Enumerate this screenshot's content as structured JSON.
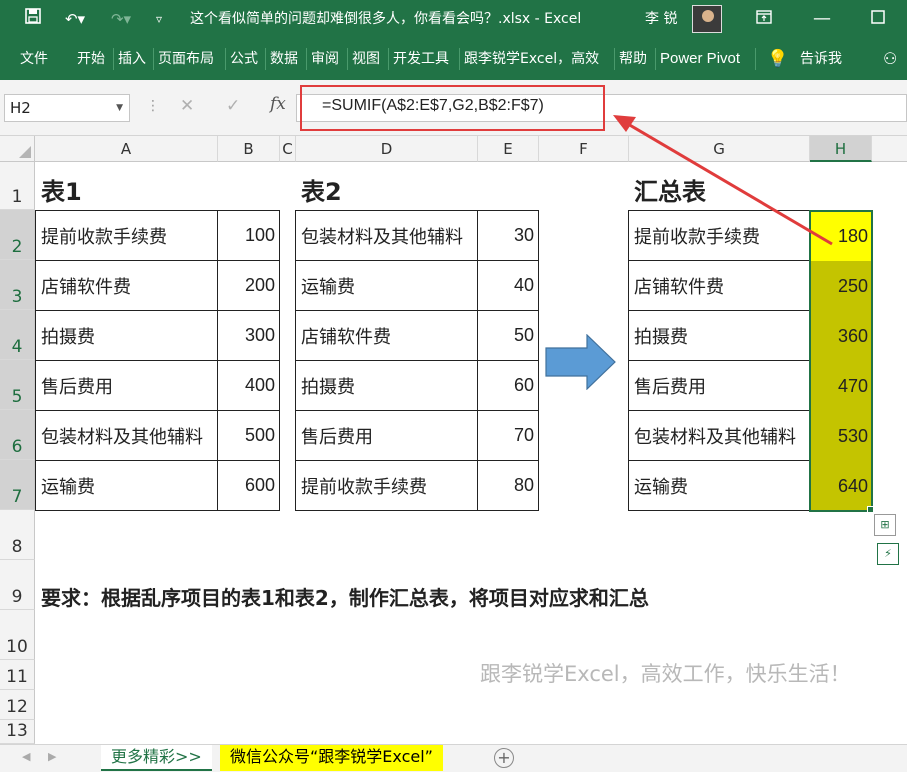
{
  "titlebar": {
    "save_icon": "save-icon",
    "undo_icon": "undo-icon",
    "redo_icon": "redo-icon",
    "doc_title": "这个看似简单的问题却难倒很多人，你看看会吗？.xlsx  -  Excel",
    "user_name": "李 锐"
  },
  "ribbon": {
    "tabs": [
      "文件",
      "开始",
      "插入",
      "页面布局",
      "公式",
      "数据",
      "审阅",
      "视图",
      "开发工具",
      "跟李锐学Excel，高效",
      "帮助",
      "Power Pivot"
    ],
    "tell_me": "告诉我"
  },
  "formula_bar": {
    "name_box": "H2",
    "formula": "=SUMIF(A$2:E$7,G2,B$2:F$7)",
    "fx_label": "fx"
  },
  "columns": [
    "A",
    "B",
    "C",
    "D",
    "E",
    "F",
    "G",
    "H"
  ],
  "rows": [
    "1",
    "2",
    "3",
    "4",
    "5",
    "6",
    "7",
    "8",
    "9",
    "10",
    "11",
    "12",
    "13"
  ],
  "table1": {
    "title": "表1",
    "items": [
      {
        "name": "提前收款手续费",
        "value": "100"
      },
      {
        "name": "店铺软件费",
        "value": "200"
      },
      {
        "name": "拍摄费",
        "value": "300"
      },
      {
        "name": "售后费用",
        "value": "400"
      },
      {
        "name": "包装材料及其他辅料",
        "value": "500"
      },
      {
        "name": "运输费",
        "value": "600"
      }
    ]
  },
  "table2": {
    "title": "表2",
    "items": [
      {
        "name": "包装材料及其他辅料",
        "value": "30"
      },
      {
        "name": "运输费",
        "value": "40"
      },
      {
        "name": "店铺软件费",
        "value": "50"
      },
      {
        "name": "拍摄费",
        "value": "60"
      },
      {
        "name": "售后费用",
        "value": "70"
      },
      {
        "name": "提前收款手续费",
        "value": "80"
      }
    ]
  },
  "summary": {
    "title": "汇总表",
    "items": [
      {
        "name": "提前收款手续费",
        "value": "180"
      },
      {
        "name": "店铺软件费",
        "value": "250"
      },
      {
        "name": "拍摄费",
        "value": "360"
      },
      {
        "name": "售后费用",
        "value": "470"
      },
      {
        "name": "包装材料及其他辅料",
        "value": "530"
      },
      {
        "name": "运输费",
        "value": "640"
      }
    ]
  },
  "requirement": "要求：根据乱序项目的表1和表2，制作汇总表，将项目对应求和汇总",
  "watermark": "跟李锐学Excel，高效工作，快乐生活！",
  "sheets": [
    "更多精彩>>",
    "微信公众号“跟李锐学Excel”"
  ],
  "colors": {
    "excel_green": "#217346",
    "highlight_yellow": "#ffff00",
    "olive": "#c4c400",
    "callout_red": "#e03c3c"
  }
}
